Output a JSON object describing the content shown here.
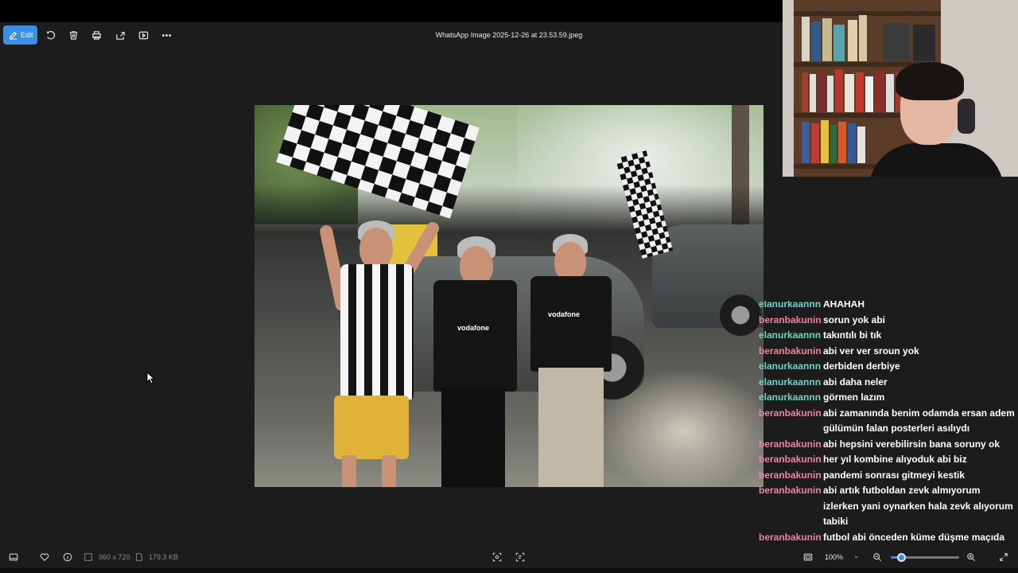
{
  "window": {
    "file_title": "WhatsApp Image 2025-12-26 at 23.53.59.jpeg"
  },
  "toolbar": {
    "edit_label": "Edit",
    "icons": [
      "rotate-icon",
      "delete-icon",
      "print-icon",
      "share-icon",
      "slideshow-icon",
      "more-icon"
    ]
  },
  "photo": {
    "jersey_sponsor": "vodafone"
  },
  "chat": {
    "messages": [
      {
        "user": "elanurkaannn",
        "text": "AHAHAH"
      },
      {
        "user": "beranbakunin",
        "text": "sorun yok abi"
      },
      {
        "user": "elanurkaannn",
        "text": "takıntılı bi tık"
      },
      {
        "user": "beranbakunin",
        "text": "abi ver ver sroun yok"
      },
      {
        "user": "elanurkaannn",
        "text": "derbiden derbiye"
      },
      {
        "user": "elanurkaannn",
        "text": "abi daha neler"
      },
      {
        "user": "elanurkaannn",
        "text": "görmen lazım"
      },
      {
        "user": "beranbakunin",
        "text": "abi zamanında benim odamda ersan adem gülümün falan posterleri asılıydı"
      },
      {
        "user": "beranbakunin",
        "text": "abi hepsini verebilirsin bana soruny ok"
      },
      {
        "user": "beranbakunin",
        "text": "her yıl kombine alıyoduk abi biz"
      },
      {
        "user": "beranbakunin",
        "text": "pandemi sonrası gitmeyi kestik"
      },
      {
        "user": "beranbakunin",
        "text": "abi artık futboldan zevk almıyorum izlerken yani oynarken hala zevk alıyorum tabiki"
      },
      {
        "user": "beranbakunin",
        "text": "futbol abi önceden küme düşme maçıda olsa izlerdim farkemteksizin"
      }
    ],
    "user_colors": {
      "elanurkaannn": "#6fd3c6",
      "beranbakunin": "#ea84a6"
    }
  },
  "statusbar": {
    "dimensions": "960 x 720",
    "file_size": "179.3 KB",
    "zoom": "100%",
    "zoom_fraction": 0.15
  },
  "colors": {
    "accent": "#3a8ee6",
    "background": "#1c1c1c"
  }
}
